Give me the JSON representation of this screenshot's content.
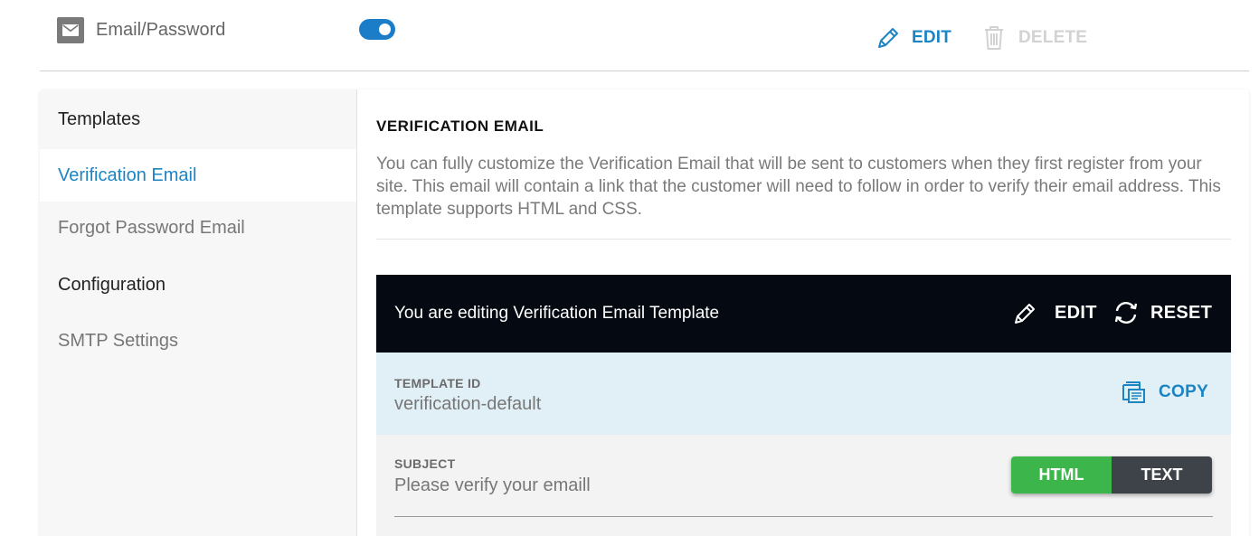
{
  "provider": {
    "name": "Email/Password",
    "icon": "envelope-icon",
    "enabled": true
  },
  "top_actions": {
    "edit_label": "EDIT",
    "delete_label": "DELETE"
  },
  "sidebar": {
    "templates_heading": "Templates",
    "items": [
      {
        "label": "Verification Email",
        "active": true
      },
      {
        "label": "Forgot Password Email",
        "active": false
      }
    ],
    "configuration_heading": "Configuration",
    "config_items": [
      {
        "label": "SMTP Settings",
        "active": false
      }
    ]
  },
  "main": {
    "title": "VERIFICATION EMAIL",
    "description": "You can fully customize the Verification Email that will be sent to customers when they first register from your site. This email will contain a link that the customer will need to follow in order to verify their email address. This template supports HTML and CSS.",
    "editor": {
      "status_text": "You are editing Verification Email Template",
      "edit_label": "EDIT",
      "reset_label": "RESET"
    },
    "template_id": {
      "label": "TEMPLATE ID",
      "value": "verification-default",
      "copy_label": "COPY"
    },
    "subject": {
      "label": "SUBJECT",
      "value": "Please verify your emaill",
      "format_options": [
        "HTML",
        "TEXT"
      ],
      "selected_format": "HTML"
    }
  },
  "colors": {
    "accent": "#1b85c4",
    "toggle_on": "#1b7dc7",
    "editor_bar": "#050a12",
    "template_id_bg": "#e1eff6",
    "html_active": "#3cb64a",
    "text_inactive": "#3d4348"
  }
}
